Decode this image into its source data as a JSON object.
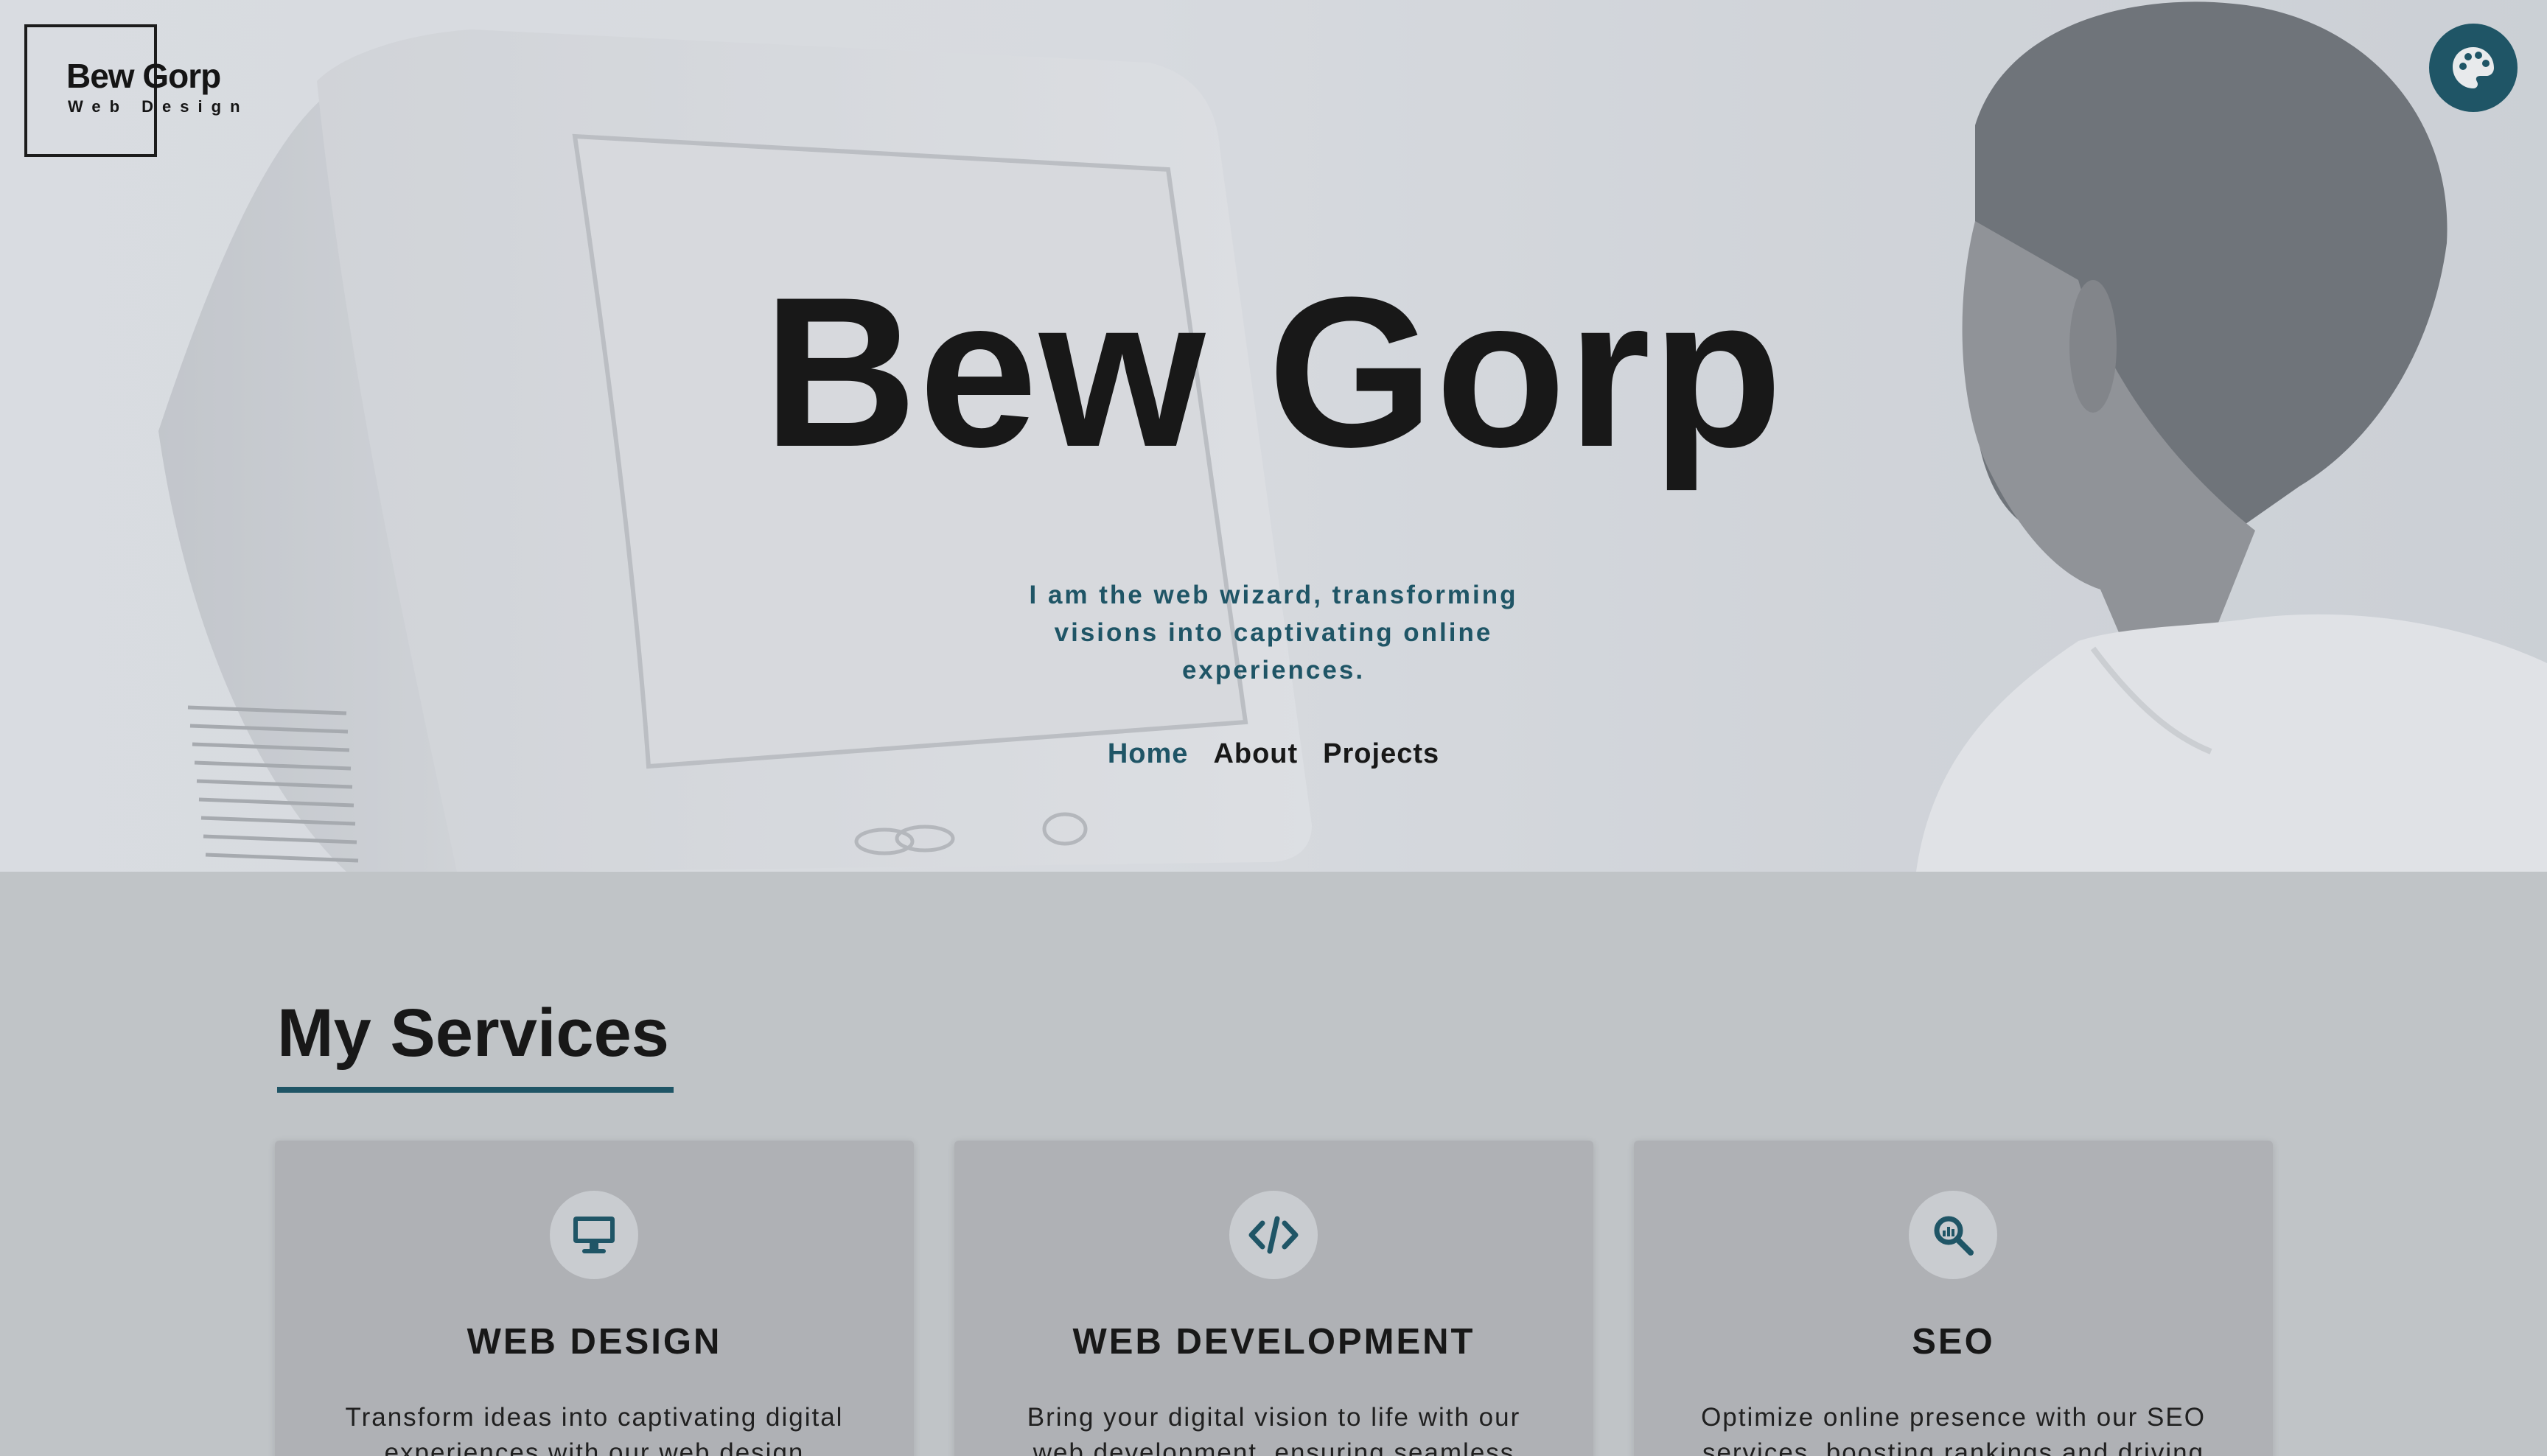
{
  "logo": {
    "title": "Bew Gorp",
    "subtitle": "Web Design"
  },
  "theme_button": {
    "icon": "palette-icon",
    "color": "#1f5566"
  },
  "hero": {
    "title": "Bew Gorp",
    "tagline": "I am the web wizard, transforming visions into captivating online experiences."
  },
  "nav": {
    "items": [
      {
        "label": "Home",
        "active": true
      },
      {
        "label": "About",
        "active": false
      },
      {
        "label": "Projects",
        "active": false
      }
    ]
  },
  "services": {
    "heading": "My Services",
    "cards": [
      {
        "icon": "monitor-icon",
        "title": "WEB DESIGN",
        "text": "Transform ideas into captivating digital experiences with our web design"
      },
      {
        "icon": "code-icon",
        "title": "WEB DEVELOPMENT",
        "text": "Bring your digital vision to life with our web development, ensuring seamless"
      },
      {
        "icon": "search-analytics-icon",
        "title": "SEO",
        "text": "Optimize online presence with our SEO services, boosting rankings and driving"
      }
    ]
  },
  "colors": {
    "accent": "#1f5566",
    "text": "#181818",
    "card_bg": "#afb1b5",
    "section_bg": "#c0c4c7"
  }
}
